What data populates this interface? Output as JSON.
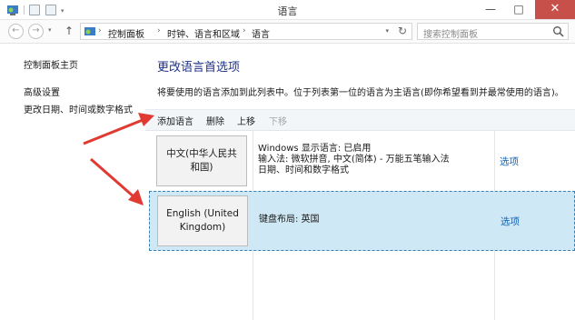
{
  "window": {
    "title": "语言",
    "minimize_glyph": "—",
    "maximize_glyph": "□",
    "close_glyph": "✕"
  },
  "nav": {
    "back_glyph": "←",
    "forward_glyph": "→",
    "dropdown_glyph": "▾",
    "up_glyph": "↑",
    "breadcrumb_sep": "›",
    "breadcrumb": [
      "控制面板",
      "时钟、语言和区域",
      "语言"
    ],
    "refresh_glyph": "↻",
    "search_placeholder": "搜索控制面板"
  },
  "sidebar": {
    "items": [
      "控制面板主页",
      "高级设置",
      "更改日期、时间或数字格式"
    ]
  },
  "main": {
    "title": "更改语言首选项",
    "description": "将要使用的语言添加到此列表中。位于列表第一位的语言为主语言(即你希望看到并最常使用的语言)。",
    "toolbar": {
      "add": "添加语言",
      "remove": "删除",
      "move_up": "上移",
      "move_down": "下移"
    },
    "languages": [
      {
        "name_line1": "中文(中华人民共",
        "name_line2": "和国)",
        "info": [
          "Windows 显示语言: 已启用",
          "输入法: 微软拼音, 中文(简体) - 万能五笔输入法",
          "日期、时间和数字格式"
        ],
        "options": "选项",
        "selected": false
      },
      {
        "name_line1": "English (United",
        "name_line2": "Kingdom)",
        "info": [
          "键盘布局: 英国"
        ],
        "options": "选项",
        "selected": true
      }
    ]
  },
  "colors": {
    "accent": "#1e3287",
    "link": "#1464b4",
    "selection": "#cfe8f6",
    "annotation_arrow": "#e03a33",
    "close_button": "#c7504a"
  }
}
